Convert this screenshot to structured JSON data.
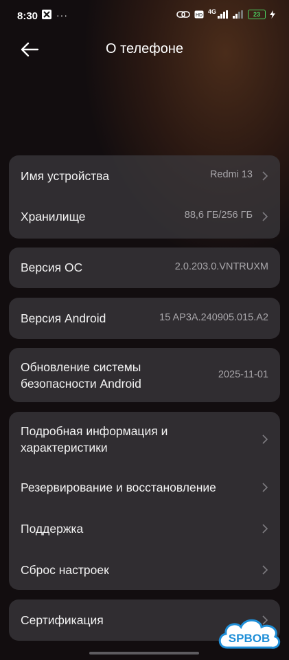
{
  "status_bar": {
    "time": "8:30",
    "more": "···",
    "network": "4G",
    "battery": "23"
  },
  "header": {
    "title": "О телефоне"
  },
  "items": {
    "device_name": {
      "label": "Имя устройства",
      "value": "Redmi 13"
    },
    "storage": {
      "label": "Хранилище",
      "value": "88,6 ГБ/256 ГБ"
    },
    "os_version": {
      "label": "Версия ОС",
      "value": "2.0.203.0.VNTRUXM"
    },
    "android_version": {
      "label": "Версия Android",
      "value": "15 AP3A.240905.015.A2"
    },
    "security_update": {
      "label_line1": "Обновление системы",
      "label_line2": "безопасности Android",
      "value": "2025-11-01"
    },
    "details": {
      "label_line1": "Подробная информация и",
      "label_line2": "характеристики"
    },
    "backup": {
      "label": "Резервирование и восстановление"
    },
    "support": {
      "label": "Поддержка"
    },
    "reset": {
      "label": "Сброс настроек"
    },
    "certification": {
      "label": "Сертификация"
    }
  },
  "watermark": {
    "text": "SPBOB"
  },
  "colors": {
    "card": "#3c3a3e",
    "value_text": "#a8a6aa",
    "battery": "#4cd964",
    "watermark": "#1f8fd8"
  }
}
